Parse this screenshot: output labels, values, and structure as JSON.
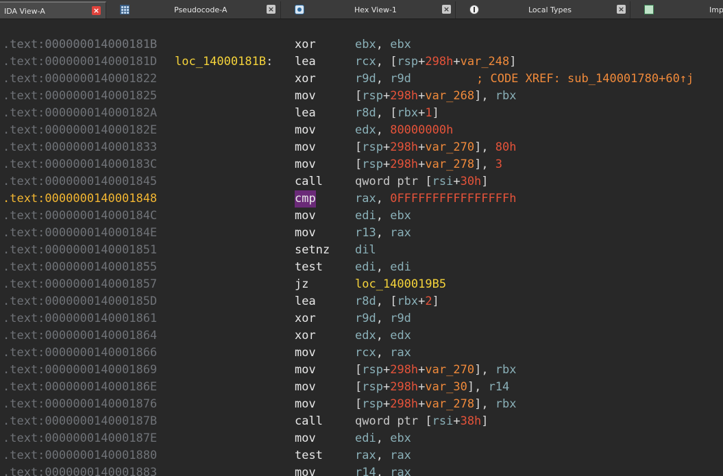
{
  "tabs": [
    {
      "label": "IDA View-A",
      "icon": "",
      "active": true
    },
    {
      "label": "Pseudocode-A",
      "icon": "pseudocode-table-icon"
    },
    {
      "label": "Hex View-1",
      "icon": "hex-view-icon"
    },
    {
      "label": "Local Types",
      "icon": "local-types-icon"
    },
    {
      "label": "Imp",
      "icon": "imports-icon"
    }
  ],
  "colors": {
    "background": "#282828",
    "address": "#6f7277",
    "address_current": "#f2b632",
    "label": "#f5d33a",
    "register": "#8ab0b8",
    "number": "#e5533a",
    "variable": "#f08a3b",
    "highlight": "#6a2a78"
  },
  "label_line": {
    "address": ".text:000000014000181B",
    "label": "loc_14000181B",
    "comment": "; CODE XREF: sub_140001780+60↑j"
  },
  "instructions": [
    {
      "address": ".text:000000014000181B",
      "mnemonic": "xor",
      "operands": [
        [
          "r",
          "ebx"
        ],
        [
          "p",
          ", "
        ],
        [
          "r",
          "ebx"
        ]
      ]
    },
    {
      "address": ".text:000000014000181D",
      "mnemonic": "lea",
      "operands": [
        [
          "r",
          "rcx"
        ],
        [
          "p",
          ", ["
        ],
        [
          "r",
          "rsp"
        ],
        [
          "p",
          "+"
        ],
        [
          "n",
          "298h"
        ],
        [
          "p",
          "+"
        ],
        [
          "v",
          "var_248"
        ],
        [
          "p",
          "]"
        ]
      ]
    },
    {
      "address": ".text:0000000140001822",
      "mnemonic": "xor",
      "operands": [
        [
          "r",
          "r9d"
        ],
        [
          "p",
          ", "
        ],
        [
          "r",
          "r9d"
        ]
      ]
    },
    {
      "address": ".text:0000000140001825",
      "mnemonic": "mov",
      "operands": [
        [
          "p",
          "["
        ],
        [
          "r",
          "rsp"
        ],
        [
          "p",
          "+"
        ],
        [
          "n",
          "298h"
        ],
        [
          "p",
          "+"
        ],
        [
          "v",
          "var_268"
        ],
        [
          "p",
          "], "
        ],
        [
          "r",
          "rbx"
        ]
      ]
    },
    {
      "address": ".text:000000014000182A",
      "mnemonic": "lea",
      "operands": [
        [
          "r",
          "r8d"
        ],
        [
          "p",
          ", ["
        ],
        [
          "r",
          "rbx"
        ],
        [
          "p",
          "+"
        ],
        [
          "n",
          "1"
        ],
        [
          "p",
          "]"
        ]
      ]
    },
    {
      "address": ".text:000000014000182E",
      "mnemonic": "mov",
      "operands": [
        [
          "r",
          "edx"
        ],
        [
          "p",
          ", "
        ],
        [
          "n",
          "80000000h"
        ]
      ]
    },
    {
      "address": ".text:0000000140001833",
      "mnemonic": "mov",
      "operands": [
        [
          "p",
          "["
        ],
        [
          "r",
          "rsp"
        ],
        [
          "p",
          "+"
        ],
        [
          "n",
          "298h"
        ],
        [
          "p",
          "+"
        ],
        [
          "v",
          "var_270"
        ],
        [
          "p",
          "], "
        ],
        [
          "n",
          "80h"
        ]
      ]
    },
    {
      "address": ".text:000000014000183C",
      "mnemonic": "mov",
      "operands": [
        [
          "p",
          "["
        ],
        [
          "r",
          "rsp"
        ],
        [
          "p",
          "+"
        ],
        [
          "n",
          "298h"
        ],
        [
          "p",
          "+"
        ],
        [
          "v",
          "var_278"
        ],
        [
          "p",
          "], "
        ],
        [
          "n",
          "3"
        ]
      ]
    },
    {
      "address": ".text:0000000140001845",
      "mnemonic": "call",
      "operands": [
        [
          "t",
          "qword ptr "
        ],
        [
          "p",
          "["
        ],
        [
          "r",
          "rsi"
        ],
        [
          "p",
          "+"
        ],
        [
          "n",
          "30h"
        ],
        [
          "p",
          "]"
        ]
      ]
    },
    {
      "address": ".text:0000000140001848",
      "mnemonic": "cmp",
      "current": true,
      "operands": [
        [
          "r",
          "rax"
        ],
        [
          "p",
          ", "
        ],
        [
          "n",
          "0FFFFFFFFFFFFFFFFh"
        ]
      ]
    },
    {
      "address": ".text:000000014000184C",
      "mnemonic": "mov",
      "operands": [
        [
          "r",
          "edi"
        ],
        [
          "p",
          ", "
        ],
        [
          "r",
          "ebx"
        ]
      ]
    },
    {
      "address": ".text:000000014000184E",
      "mnemonic": "mov",
      "operands": [
        [
          "r",
          "r13"
        ],
        [
          "p",
          ", "
        ],
        [
          "r",
          "rax"
        ]
      ]
    },
    {
      "address": ".text:0000000140001851",
      "mnemonic": "setnz",
      "operands": [
        [
          "r",
          "dil"
        ]
      ]
    },
    {
      "address": ".text:0000000140001855",
      "mnemonic": "test",
      "operands": [
        [
          "r",
          "edi"
        ],
        [
          "p",
          ", "
        ],
        [
          "r",
          "edi"
        ]
      ]
    },
    {
      "address": ".text:0000000140001857",
      "mnemonic": "jz",
      "operands": [
        [
          "l",
          "loc_1400019B5"
        ]
      ]
    },
    {
      "address": ".text:000000014000185D",
      "mnemonic": "lea",
      "operands": [
        [
          "r",
          "r8d"
        ],
        [
          "p",
          ", ["
        ],
        [
          "r",
          "rbx"
        ],
        [
          "p",
          "+"
        ],
        [
          "n",
          "2"
        ],
        [
          "p",
          "]"
        ]
      ]
    },
    {
      "address": ".text:0000000140001861",
      "mnemonic": "xor",
      "operands": [
        [
          "r",
          "r9d"
        ],
        [
          "p",
          ", "
        ],
        [
          "r",
          "r9d"
        ]
      ]
    },
    {
      "address": ".text:0000000140001864",
      "mnemonic": "xor",
      "operands": [
        [
          "r",
          "edx"
        ],
        [
          "p",
          ", "
        ],
        [
          "r",
          "edx"
        ]
      ]
    },
    {
      "address": ".text:0000000140001866",
      "mnemonic": "mov",
      "operands": [
        [
          "r",
          "rcx"
        ],
        [
          "p",
          ", "
        ],
        [
          "r",
          "rax"
        ]
      ]
    },
    {
      "address": ".text:0000000140001869",
      "mnemonic": "mov",
      "operands": [
        [
          "p",
          "["
        ],
        [
          "r",
          "rsp"
        ],
        [
          "p",
          "+"
        ],
        [
          "n",
          "298h"
        ],
        [
          "p",
          "+"
        ],
        [
          "v",
          "var_270"
        ],
        [
          "p",
          "], "
        ],
        [
          "r",
          "rbx"
        ]
      ]
    },
    {
      "address": ".text:000000014000186E",
      "mnemonic": "mov",
      "operands": [
        [
          "p",
          "["
        ],
        [
          "r",
          "rsp"
        ],
        [
          "p",
          "+"
        ],
        [
          "n",
          "298h"
        ],
        [
          "p",
          "+"
        ],
        [
          "v",
          "var_30"
        ],
        [
          "p",
          "], "
        ],
        [
          "r",
          "r14"
        ]
      ]
    },
    {
      "address": ".text:0000000140001876",
      "mnemonic": "mov",
      "operands": [
        [
          "p",
          "["
        ],
        [
          "r",
          "rsp"
        ],
        [
          "p",
          "+"
        ],
        [
          "n",
          "298h"
        ],
        [
          "p",
          "+"
        ],
        [
          "v",
          "var_278"
        ],
        [
          "p",
          "], "
        ],
        [
          "r",
          "rbx"
        ]
      ]
    },
    {
      "address": ".text:000000014000187B",
      "mnemonic": "call",
      "operands": [
        [
          "t",
          "qword ptr "
        ],
        [
          "p",
          "["
        ],
        [
          "r",
          "rsi"
        ],
        [
          "p",
          "+"
        ],
        [
          "n",
          "38h"
        ],
        [
          "p",
          "]"
        ]
      ]
    },
    {
      "address": ".text:000000014000187E",
      "mnemonic": "mov",
      "operands": [
        [
          "r",
          "edi"
        ],
        [
          "p",
          ", "
        ],
        [
          "r",
          "ebx"
        ]
      ]
    },
    {
      "address": ".text:0000000140001880",
      "mnemonic": "test",
      "operands": [
        [
          "r",
          "rax"
        ],
        [
          "p",
          ", "
        ],
        [
          "r",
          "rax"
        ]
      ]
    },
    {
      "address": ".text:0000000140001883",
      "mnemonic": "mov",
      "operands": [
        [
          "r",
          "r14"
        ],
        [
          "p",
          ", "
        ],
        [
          "r",
          "rax"
        ]
      ]
    }
  ]
}
